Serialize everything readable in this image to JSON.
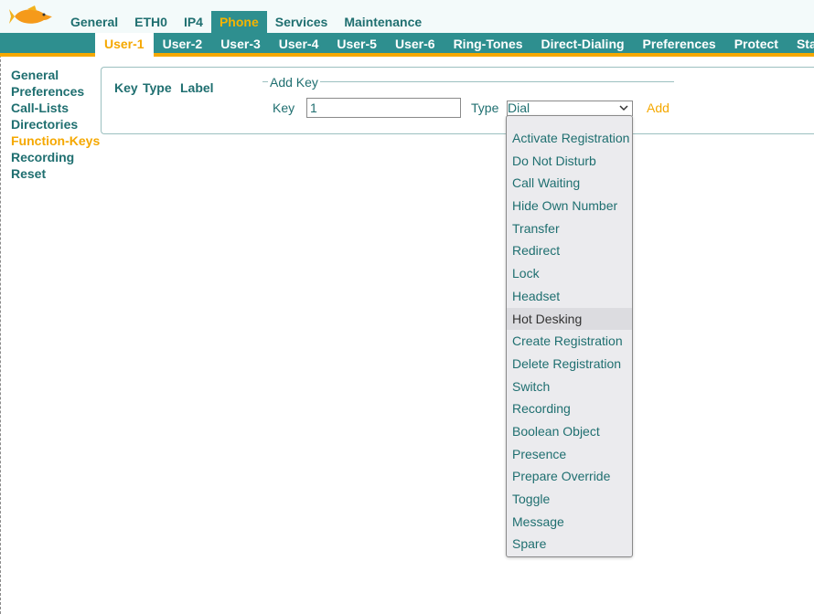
{
  "top_nav": {
    "items": [
      "General",
      "ETH0",
      "IP4",
      "Phone",
      "Services",
      "Maintenance"
    ],
    "active": "Phone"
  },
  "sub_nav": {
    "items": [
      "User-1",
      "User-2",
      "User-3",
      "User-4",
      "User-5",
      "User-6",
      "Ring-Tones",
      "Direct-Dialing",
      "Preferences",
      "Protect",
      "State"
    ],
    "active": "User-1"
  },
  "side_menu": {
    "items": [
      "General",
      "Preferences",
      "Call-Lists",
      "Directories",
      "Function-Keys",
      "Recording",
      "Reset"
    ],
    "active": "Function-Keys"
  },
  "table_headers": {
    "key": "Key",
    "type": "Type",
    "label": "Label"
  },
  "add_key": {
    "legend": "Add Key",
    "key_label": "Key",
    "key_value": "1",
    "type_label": "Type",
    "type_value": "Dial",
    "add_link": "Add"
  },
  "dropdown": {
    "options": [
      "Activate Registration",
      "Do Not Disturb",
      "Call Waiting",
      "Hide Own Number",
      "Transfer",
      "Redirect",
      "Lock",
      "Headset",
      "Hot Desking",
      "Create Registration",
      "Delete Registration",
      "Switch",
      "Recording",
      "Boolean Object",
      "Presence",
      "Prepare Override",
      "Toggle",
      "Message",
      "Spare"
    ],
    "hovered": "Hot Desking"
  },
  "colors": {
    "teal": "#2e8f8f",
    "text": "#1f6f70",
    "accent": "#f5a800"
  },
  "icons": {
    "logo": "goldfish-logo",
    "select_arrow": "chevron-down-icon"
  }
}
